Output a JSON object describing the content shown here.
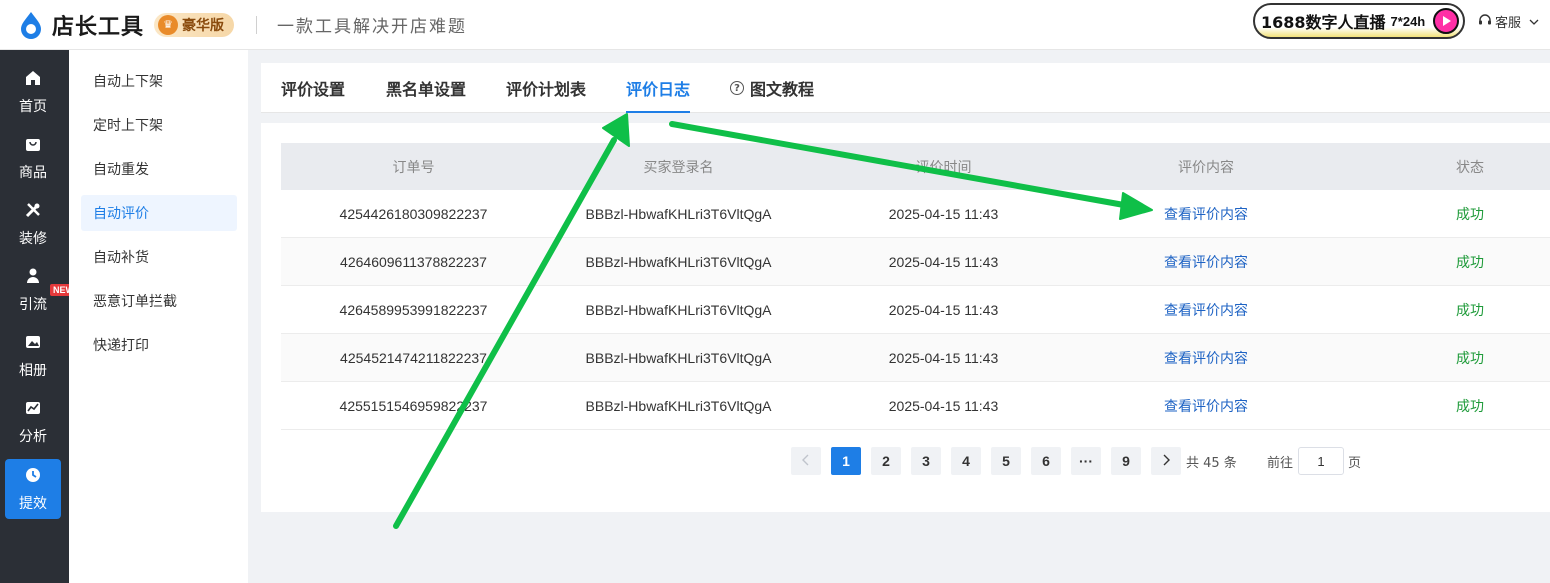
{
  "header": {
    "app_title": "店长工具",
    "edition": "豪华版",
    "slogan": "一款工具解决开店难题",
    "live_banner": "1688数字人直播",
    "live_hours": "7*24h",
    "service_label": "客服"
  },
  "rail": {
    "items": [
      {
        "label": "首页",
        "icon": "home-icon"
      },
      {
        "label": "商品",
        "icon": "bag-icon"
      },
      {
        "label": "装修",
        "icon": "tools-icon"
      },
      {
        "label": "引流",
        "icon": "person-icon"
      },
      {
        "label": "相册",
        "icon": "image-icon"
      },
      {
        "label": "分析",
        "icon": "chart-icon"
      },
      {
        "label": "提效",
        "icon": "clock-icon"
      }
    ],
    "new_tag": "NEW",
    "active": "提效"
  },
  "submenu": {
    "items": [
      "自动上下架",
      "定时上下架",
      "自动重发",
      "自动评价",
      "自动补货",
      "恶意订单拦截",
      "快递打印"
    ],
    "active": "自动评价"
  },
  "tabs": {
    "items": [
      "评价设置",
      "黑名单设置",
      "评价计划表",
      "评价日志",
      "图文教程"
    ],
    "active": "评价日志"
  },
  "table": {
    "headers": [
      "订单号",
      "买家登录名",
      "评价时间",
      "评价内容",
      "状态"
    ],
    "rows": [
      {
        "order": "4254426180309822237",
        "buyer": "BBBzl-HbwafKHLri3T6VltQgA",
        "time": "2025-04-15 11:43",
        "content": "查看评价内容",
        "status": "成功"
      },
      {
        "order": "4264609611378822237",
        "buyer": "BBBzl-HbwafKHLri3T6VltQgA",
        "time": "2025-04-15 11:43",
        "content": "查看评价内容",
        "status": "成功"
      },
      {
        "order": "4264589953991822237",
        "buyer": "BBBzl-HbwafKHLri3T6VltQgA",
        "time": "2025-04-15 11:43",
        "content": "查看评价内容",
        "status": "成功"
      },
      {
        "order": "4254521474211822237",
        "buyer": "BBBzl-HbwafKHLri3T6VltQgA",
        "time": "2025-04-15 11:43",
        "content": "查看评价内容",
        "status": "成功"
      },
      {
        "order": "4255151546959822237",
        "buyer": "BBBzl-HbwafKHLri3T6VltQgA",
        "time": "2025-04-15 11:43",
        "content": "查看评价内容",
        "status": "成功"
      }
    ]
  },
  "pagination": {
    "pages": [
      "1",
      "2",
      "3",
      "4",
      "5",
      "6",
      "···",
      "9"
    ],
    "current": "1",
    "total_text": "共 45 条",
    "goto_label": "前往",
    "goto_value": "1",
    "page_suffix": "页"
  },
  "colors": {
    "accent": "#1e7ee6",
    "success": "#1f9b3a",
    "annotation_arrow": "#0fbf48",
    "rail_bg": "#2b2f36"
  }
}
